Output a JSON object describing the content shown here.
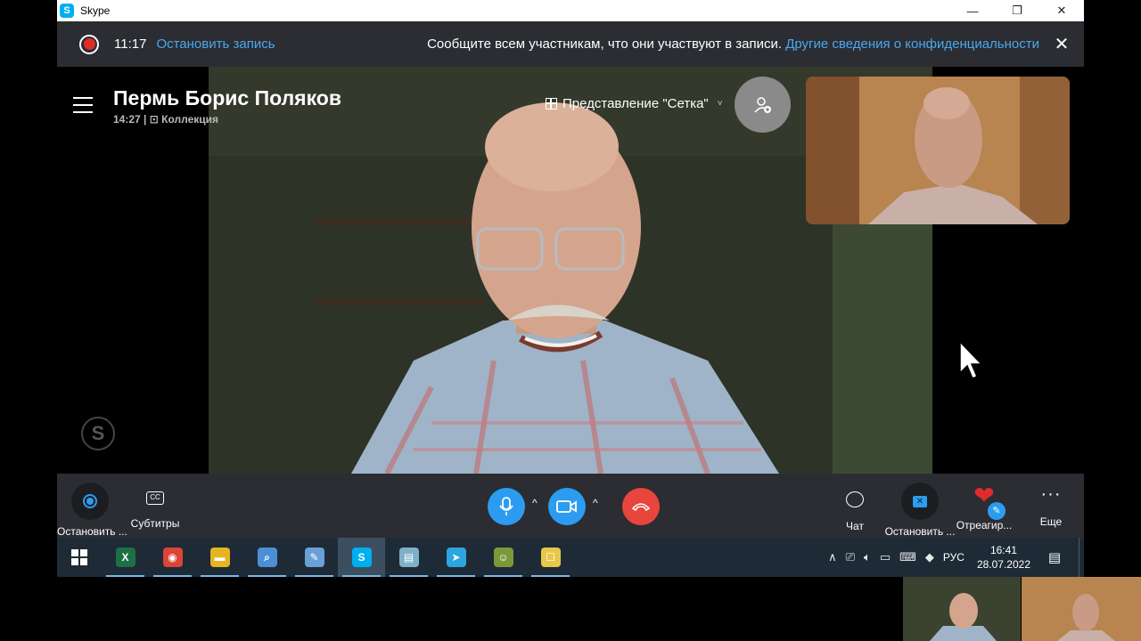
{
  "window": {
    "title": "Skype",
    "logo_letter": "S",
    "minimize": "—",
    "maximize": "❐",
    "close": "✕"
  },
  "recording_bar": {
    "time": "11:17",
    "stop_link": "Остановить запись",
    "message": "Сообщите всем участникам, что они участвуют в записи.",
    "privacy_link": "Другие сведения о конфиденциальности",
    "close": "✕"
  },
  "call": {
    "name": "Пермь Борис Поляков",
    "duration": "14:27",
    "separator": "|",
    "collection": "Коллекция",
    "view_mode": "Представление \"Сетка\"",
    "view_chevron": "˅",
    "add_people_icon": "person-add-icon",
    "watermark": "S"
  },
  "controls": {
    "stop_recording": "Остановить ...",
    "subtitles": "Субтитры",
    "subtitles_icon": "CC",
    "chat": "Чат",
    "stop_sharing": "Остановить ...",
    "react": "Отреагир...",
    "more": "Еще",
    "more_icon": "···",
    "caret": "^",
    "heart": "❤",
    "pen": "✎",
    "colors": {
      "accent": "#2c9cf0",
      "hangup": "#e8453c",
      "bar_bg": "#2b2d33"
    }
  },
  "taskbar": {
    "apps": [
      {
        "name": "excel",
        "glyph": "X",
        "color": "#1d7044",
        "active": false
      },
      {
        "name": "chrome",
        "glyph": "◉",
        "color": "#db4437",
        "active": false
      },
      {
        "name": "explorer",
        "glyph": "▬",
        "color": "#e6b422",
        "active": false
      },
      {
        "name": "magnifier",
        "glyph": "⌕",
        "color": "#4d8fd6",
        "active": false
      },
      {
        "name": "paint",
        "glyph": "✎",
        "color": "#6aa0d8",
        "active": false
      },
      {
        "name": "skype",
        "glyph": "S",
        "color": "#00aff0",
        "active": true
      },
      {
        "name": "notes",
        "glyph": "▤",
        "color": "#7fb0c8",
        "active": false
      },
      {
        "name": "telegram",
        "glyph": "➤",
        "color": "#2ca5e0",
        "active": false
      },
      {
        "name": "game",
        "glyph": "☺",
        "color": "#7a9a3a",
        "active": false
      },
      {
        "name": "sticky",
        "glyph": "☐",
        "color": "#e8c84a",
        "active": false
      }
    ],
    "tray": {
      "up_arrow": "∧",
      "lang": "РУС",
      "time": "16:41",
      "date": "28.07.2022"
    }
  }
}
